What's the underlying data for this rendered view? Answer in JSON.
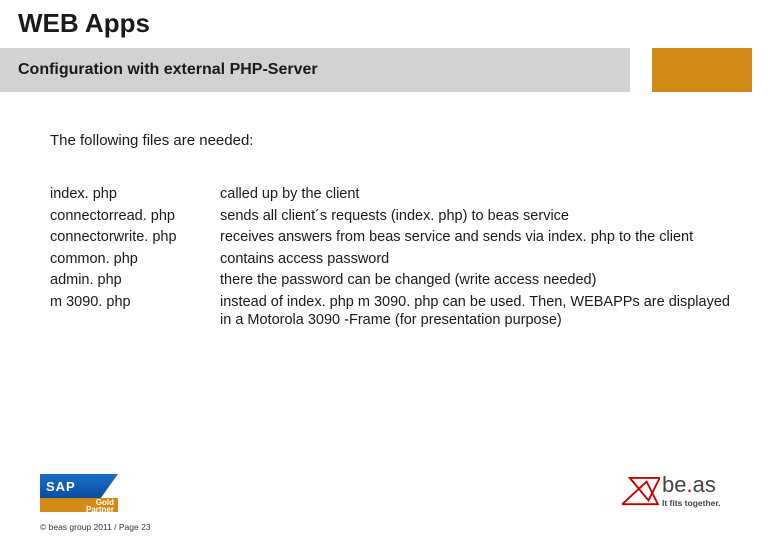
{
  "header": {
    "title": "WEB Apps",
    "subtitle": "Configuration with external PHP-Server"
  },
  "body": {
    "intro": "The following files are needed:",
    "files": [
      {
        "name": "index. php",
        "desc": "called up by the client"
      },
      {
        "name": "connectorread. php",
        "desc": "sends all client´s requests (index. php) to beas service"
      },
      {
        "name": "connectorwrite. php",
        "desc": "receives answers from beas service and sends via index. php to the client"
      },
      {
        "name": "common. php",
        "desc": "contains access password"
      },
      {
        "name": "admin. php",
        "desc": "there the password can be changed (write access needed)"
      },
      {
        "name": "m 3090. php",
        "desc": "instead of index. php m 3090. php can be used. Then, WEBAPPs are displayed in a Motorola 3090 -Frame (for presentation purpose)"
      }
    ]
  },
  "footer": {
    "sap": {
      "brand": "SAP",
      "gold1": "Gold",
      "gold2": "Partner"
    },
    "beas": {
      "name_b": "b",
      "name_e": "e",
      "dot": ".",
      "name_a": "a",
      "name_s": "s",
      "tagline": "It fits together."
    },
    "copyright": "© beas group 2011 / Page 23"
  }
}
